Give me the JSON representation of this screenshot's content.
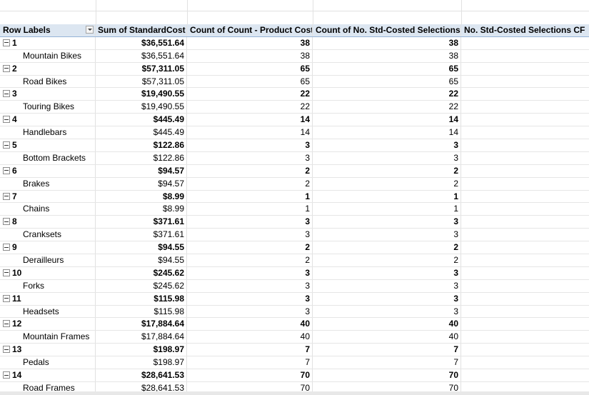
{
  "pivot": {
    "headers": [
      "Row Labels",
      "Sum of StandardCost",
      "Count of Count - Product Cost",
      "Count of No. Std-Costed Selections",
      "No. Std-Costed Selections CF"
    ],
    "rows": [
      {
        "type": "group",
        "label": "1",
        "cost": "$36,551.64",
        "count_cost": "38",
        "count_sel": "38",
        "cf": ""
      },
      {
        "type": "item",
        "label": "Mountain Bikes",
        "cost": "$36,551.64",
        "count_cost": "38",
        "count_sel": "38",
        "cf": ""
      },
      {
        "type": "group",
        "label": "2",
        "cost": "$57,311.05",
        "count_cost": "65",
        "count_sel": "65",
        "cf": ""
      },
      {
        "type": "item",
        "label": "Road Bikes",
        "cost": "$57,311.05",
        "count_cost": "65",
        "count_sel": "65",
        "cf": ""
      },
      {
        "type": "group",
        "label": "3",
        "cost": "$19,490.55",
        "count_cost": "22",
        "count_sel": "22",
        "cf": ""
      },
      {
        "type": "item",
        "label": "Touring Bikes",
        "cost": "$19,490.55",
        "count_cost": "22",
        "count_sel": "22",
        "cf": ""
      },
      {
        "type": "group",
        "label": "4",
        "cost": "$445.49",
        "count_cost": "14",
        "count_sel": "14",
        "cf": ""
      },
      {
        "type": "item",
        "label": "Handlebars",
        "cost": "$445.49",
        "count_cost": "14",
        "count_sel": "14",
        "cf": ""
      },
      {
        "type": "group",
        "label": "5",
        "cost": "$122.86",
        "count_cost": "3",
        "count_sel": "3",
        "cf": ""
      },
      {
        "type": "item",
        "label": "Bottom Brackets",
        "cost": "$122.86",
        "count_cost": "3",
        "count_sel": "3",
        "cf": ""
      },
      {
        "type": "group",
        "label": "6",
        "cost": "$94.57",
        "count_cost": "2",
        "count_sel": "2",
        "cf": ""
      },
      {
        "type": "item",
        "label": "Brakes",
        "cost": "$94.57",
        "count_cost": "2",
        "count_sel": "2",
        "cf": ""
      },
      {
        "type": "group",
        "label": "7",
        "cost": "$8.99",
        "count_cost": "1",
        "count_sel": "1",
        "cf": ""
      },
      {
        "type": "item",
        "label": "Chains",
        "cost": "$8.99",
        "count_cost": "1",
        "count_sel": "1",
        "cf": ""
      },
      {
        "type": "group",
        "label": "8",
        "cost": "$371.61",
        "count_cost": "3",
        "count_sel": "3",
        "cf": ""
      },
      {
        "type": "item",
        "label": "Cranksets",
        "cost": "$371.61",
        "count_cost": "3",
        "count_sel": "3",
        "cf": ""
      },
      {
        "type": "group",
        "label": "9",
        "cost": "$94.55",
        "count_cost": "2",
        "count_sel": "2",
        "cf": ""
      },
      {
        "type": "item",
        "label": "Derailleurs",
        "cost": "$94.55",
        "count_cost": "2",
        "count_sel": "2",
        "cf": ""
      },
      {
        "type": "group",
        "label": "10",
        "cost": "$245.62",
        "count_cost": "3",
        "count_sel": "3",
        "cf": ""
      },
      {
        "type": "item",
        "label": "Forks",
        "cost": "$245.62",
        "count_cost": "3",
        "count_sel": "3",
        "cf": ""
      },
      {
        "type": "group",
        "label": "11",
        "cost": "$115.98",
        "count_cost": "3",
        "count_sel": "3",
        "cf": ""
      },
      {
        "type": "item",
        "label": "Headsets",
        "cost": "$115.98",
        "count_cost": "3",
        "count_sel": "3",
        "cf": ""
      },
      {
        "type": "group",
        "label": "12",
        "cost": "$17,884.64",
        "count_cost": "40",
        "count_sel": "40",
        "cf": ""
      },
      {
        "type": "item",
        "label": "Mountain Frames",
        "cost": "$17,884.64",
        "count_cost": "40",
        "count_sel": "40",
        "cf": ""
      },
      {
        "type": "group",
        "label": "13",
        "cost": "$198.97",
        "count_cost": "7",
        "count_sel": "7",
        "cf": ""
      },
      {
        "type": "item",
        "label": "Pedals",
        "cost": "$198.97",
        "count_cost": "7",
        "count_sel": "7",
        "cf": ""
      },
      {
        "type": "group",
        "label": "14",
        "cost": "$28,641.53",
        "count_cost": "70",
        "count_sel": "70",
        "cf": ""
      },
      {
        "type": "item",
        "label": "Road Frames",
        "cost": "$28,641.53",
        "count_cost": "70",
        "count_sel": "70",
        "cf": ""
      }
    ]
  },
  "colors": {
    "header_bg": "#dce6f1",
    "header_border": "#95b3d7",
    "gridline": "#e1e1e1"
  },
  "icons": {
    "collapse": "collapse-minus-icon",
    "filter": "filter-dropdown-icon"
  }
}
